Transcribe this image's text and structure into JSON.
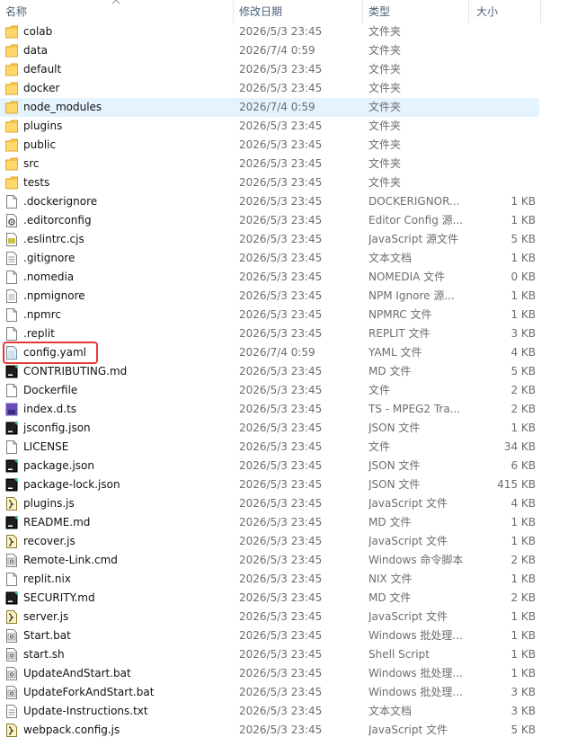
{
  "columns": {
    "name": "名称",
    "modified": "修改日期",
    "type": "类型",
    "size": "大小"
  },
  "accent_colors": {
    "selection": "#e5f3ff",
    "highlight": "#e53935",
    "folder": "#f6c54a"
  },
  "files": [
    {
      "name": "colab",
      "modified": "2026/5/3 23:45",
      "type": "文件夹",
      "size": "",
      "icon": "folder-icon"
    },
    {
      "name": "data",
      "modified": "2026/7/4 0:59",
      "type": "文件夹",
      "size": "",
      "icon": "folder-icon"
    },
    {
      "name": "default",
      "modified": "2026/5/3 23:45",
      "type": "文件夹",
      "size": "",
      "icon": "folder-icon"
    },
    {
      "name": "docker",
      "modified": "2026/5/3 23:45",
      "type": "文件夹",
      "size": "",
      "icon": "folder-icon"
    },
    {
      "name": "node_modules",
      "modified": "2026/7/4 0:59",
      "type": "文件夹",
      "size": "",
      "icon": "folder-icon",
      "selected": true
    },
    {
      "name": "plugins",
      "modified": "2026/5/3 23:45",
      "type": "文件夹",
      "size": "",
      "icon": "folder-icon"
    },
    {
      "name": "public",
      "modified": "2026/5/3 23:45",
      "type": "文件夹",
      "size": "",
      "icon": "folder-icon"
    },
    {
      "name": "src",
      "modified": "2026/5/3 23:45",
      "type": "文件夹",
      "size": "",
      "icon": "folder-icon"
    },
    {
      "name": "tests",
      "modified": "2026/5/3 23:45",
      "type": "文件夹",
      "size": "",
      "icon": "folder-icon"
    },
    {
      "name": ".dockerignore",
      "modified": "2026/5/3 23:45",
      "type": "DOCKERIGNOR...",
      "size": "1 KB",
      "icon": "blank-file-icon"
    },
    {
      "name": ".editorconfig",
      "modified": "2026/5/3 23:45",
      "type": "Editor Config 源...",
      "size": "1 KB",
      "icon": "gear-file-icon"
    },
    {
      "name": ".eslintrc.cjs",
      "modified": "2026/5/3 23:45",
      "type": "JavaScript 源文件",
      "size": "5 KB",
      "icon": "js-file-icon"
    },
    {
      "name": ".gitignore",
      "modified": "2026/5/3 23:45",
      "type": "文本文档",
      "size": "1 KB",
      "icon": "text-file-icon"
    },
    {
      "name": ".nomedia",
      "modified": "2026/5/3 23:45",
      "type": "NOMEDIA 文件",
      "size": "0 KB",
      "icon": "blank-file-icon"
    },
    {
      "name": ".npmignore",
      "modified": "2026/5/3 23:45",
      "type": "NPM Ignore 源...",
      "size": "1 KB",
      "icon": "text-file-icon"
    },
    {
      "name": ".npmrc",
      "modified": "2026/5/3 23:45",
      "type": "NPMRC 文件",
      "size": "1 KB",
      "icon": "blank-file-icon"
    },
    {
      "name": ".replit",
      "modified": "2026/5/3 23:45",
      "type": "REPLIT 文件",
      "size": "3 KB",
      "icon": "blank-file-icon"
    },
    {
      "name": "config.yaml",
      "modified": "2026/7/4 0:59",
      "type": "YAML 文件",
      "size": "4 KB",
      "icon": "yaml-file-icon"
    },
    {
      "name": "CONTRIBUTING.md",
      "modified": "2026/5/3 23:45",
      "type": "MD 文件",
      "size": "5 KB",
      "icon": "pycharm-file-icon"
    },
    {
      "name": "Dockerfile",
      "modified": "2026/5/3 23:45",
      "type": "文件",
      "size": "2 KB",
      "icon": "blank-file-icon"
    },
    {
      "name": "index.d.ts",
      "modified": "2026/5/3 23:45",
      "type": "TS - MPEG2 Tra...",
      "size": "2 KB",
      "icon": "ts-file-icon"
    },
    {
      "name": "jsconfig.json",
      "modified": "2026/5/3 23:45",
      "type": "JSON 文件",
      "size": "1 KB",
      "icon": "pycharm-file-icon"
    },
    {
      "name": "LICENSE",
      "modified": "2026/5/3 23:45",
      "type": "文件",
      "size": "34 KB",
      "icon": "blank-file-icon"
    },
    {
      "name": "package.json",
      "modified": "2026/5/3 23:45",
      "type": "JSON 文件",
      "size": "6 KB",
      "icon": "pycharm-file-icon"
    },
    {
      "name": "package-lock.json",
      "modified": "2026/5/3 23:45",
      "type": "JSON 文件",
      "size": "415 KB",
      "icon": "pycharm-file-icon"
    },
    {
      "name": "plugins.js",
      "modified": "2026/5/3 23:45",
      "type": "JavaScript 文件",
      "size": "4 KB",
      "icon": "script-file-icon"
    },
    {
      "name": "README.md",
      "modified": "2026/5/3 23:45",
      "type": "MD 文件",
      "size": "1 KB",
      "icon": "pycharm-file-icon"
    },
    {
      "name": "recover.js",
      "modified": "2026/5/3 23:45",
      "type": "JavaScript 文件",
      "size": "1 KB",
      "icon": "script-file-icon"
    },
    {
      "name": "Remote-Link.cmd",
      "modified": "2026/5/3 23:45",
      "type": "Windows 命令脚本",
      "size": "2 KB",
      "icon": "batch-file-icon"
    },
    {
      "name": "replit.nix",
      "modified": "2026/5/3 23:45",
      "type": "NIX 文件",
      "size": "1 KB",
      "icon": "blank-file-icon"
    },
    {
      "name": "SECURITY.md",
      "modified": "2026/5/3 23:45",
      "type": "MD 文件",
      "size": "2 KB",
      "icon": "pycharm-file-icon"
    },
    {
      "name": "server.js",
      "modified": "2026/5/3 23:45",
      "type": "JavaScript 文件",
      "size": "1 KB",
      "icon": "script-file-icon"
    },
    {
      "name": "Start.bat",
      "modified": "2026/5/3 23:45",
      "type": "Windows 批处理...",
      "size": "1 KB",
      "icon": "batch-file-icon"
    },
    {
      "name": "start.sh",
      "modified": "2026/5/3 23:45",
      "type": "Shell Script",
      "size": "1 KB",
      "icon": "batch-file-icon"
    },
    {
      "name": "UpdateAndStart.bat",
      "modified": "2026/5/3 23:45",
      "type": "Windows 批处理...",
      "size": "1 KB",
      "icon": "batch-file-icon"
    },
    {
      "name": "UpdateForkAndStart.bat",
      "modified": "2026/5/3 23:45",
      "type": "Windows 批处理...",
      "size": "3 KB",
      "icon": "batch-file-icon"
    },
    {
      "name": "Update-Instructions.txt",
      "modified": "2026/5/3 23:45",
      "type": "文本文档",
      "size": "3 KB",
      "icon": "text-file-icon"
    },
    {
      "name": "webpack.config.js",
      "modified": "2026/5/3 23:45",
      "type": "JavaScript 文件",
      "size": "5 KB",
      "icon": "script-file-icon"
    }
  ]
}
